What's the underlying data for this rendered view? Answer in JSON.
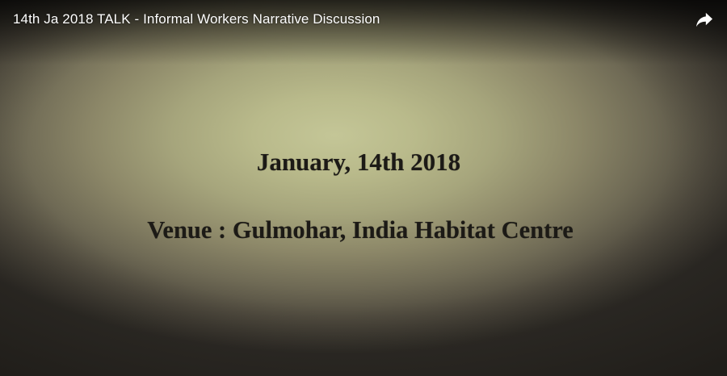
{
  "player": {
    "title": "14th Ja 2018 TALK - Informal Workers Narrative Discussion",
    "share_icon": "share-icon"
  },
  "slide": {
    "date": "January, 14th 2018",
    "venue": "Venue : Gulmohar, India Habitat Centre"
  },
  "colors": {
    "title_text": "#ffffff",
    "slide_text": "#1c1a16",
    "background_center": "#c4c697",
    "background_edge": "#2f2c27"
  }
}
